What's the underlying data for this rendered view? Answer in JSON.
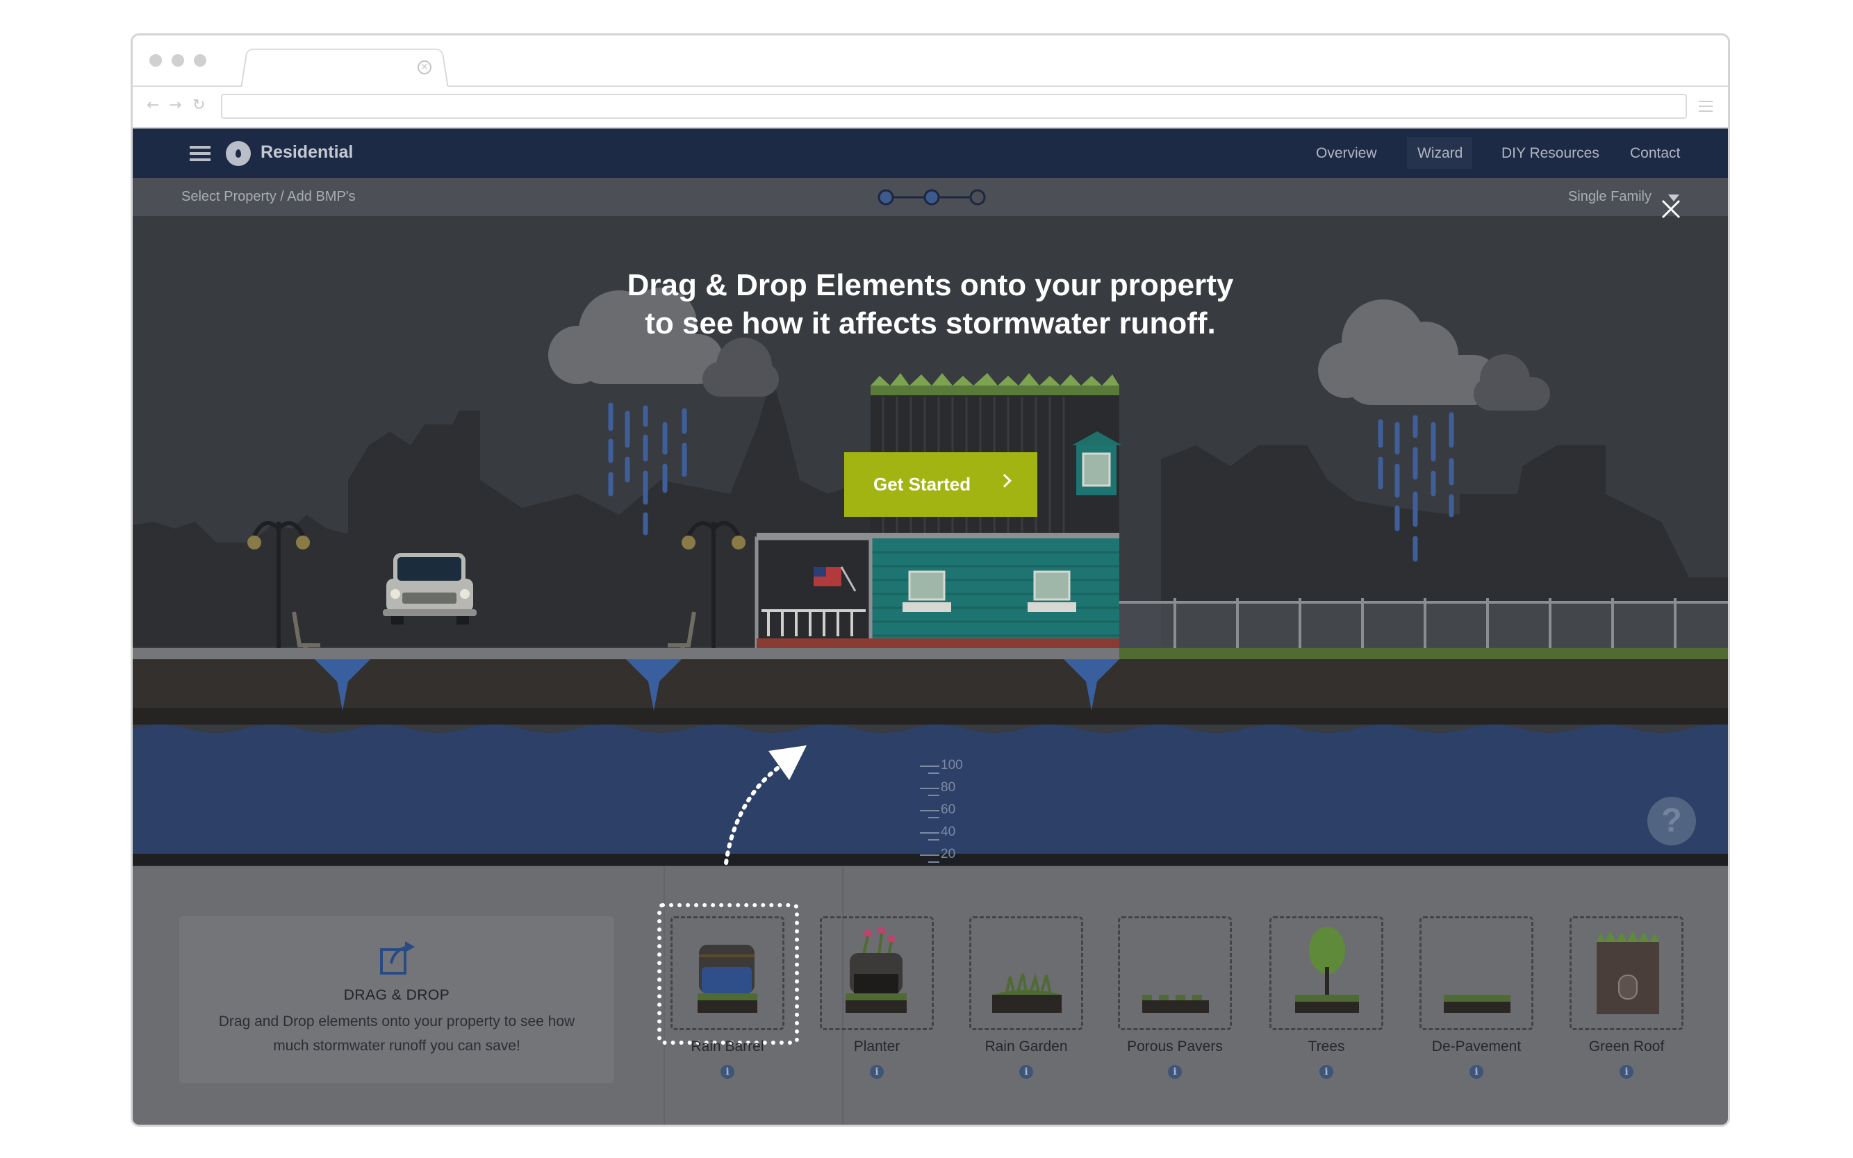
{
  "app": {
    "brand": "Residential",
    "nav": {
      "overview": "Overview",
      "wizard": "Wizard",
      "diy": "DIY Resources",
      "contact": "Contact"
    },
    "breadcrumb": "Select Property / Add BMP's",
    "steps": {
      "current": 2,
      "total": 3
    },
    "property_type": "Single Family"
  },
  "overlay": {
    "headline_line1": "Drag & Drop Elements onto your property",
    "headline_line2": "to see how it affects stormwater runoff.",
    "cta": "Get Started"
  },
  "gauge": {
    "labels": [
      "100",
      "80",
      "60",
      "40",
      "20"
    ]
  },
  "help": {
    "glyph": "?"
  },
  "dragdrop": {
    "title": "DRAG & DROP",
    "description": "Drag and Drop elements onto your property to see how much stormwater runoff you can save!"
  },
  "elements": [
    {
      "label": "Rain Barrel",
      "icon": "rain-barrel-icon"
    },
    {
      "label": "Planter",
      "icon": "planter-icon"
    },
    {
      "label": "Rain Garden",
      "icon": "rain-garden-icon"
    },
    {
      "label": "Porous Pavers",
      "icon": "porous-pavers-icon"
    },
    {
      "label": "Trees",
      "icon": "tree-icon"
    },
    {
      "label": "De-Pavement",
      "icon": "de-pavement-icon"
    },
    {
      "label": "Green Roof",
      "icon": "green-roof-icon"
    }
  ],
  "colors": {
    "nav_bg": "#1d2a45",
    "cta": "#a2b412",
    "water": "#2c4068",
    "panel": "#6b6d71"
  }
}
